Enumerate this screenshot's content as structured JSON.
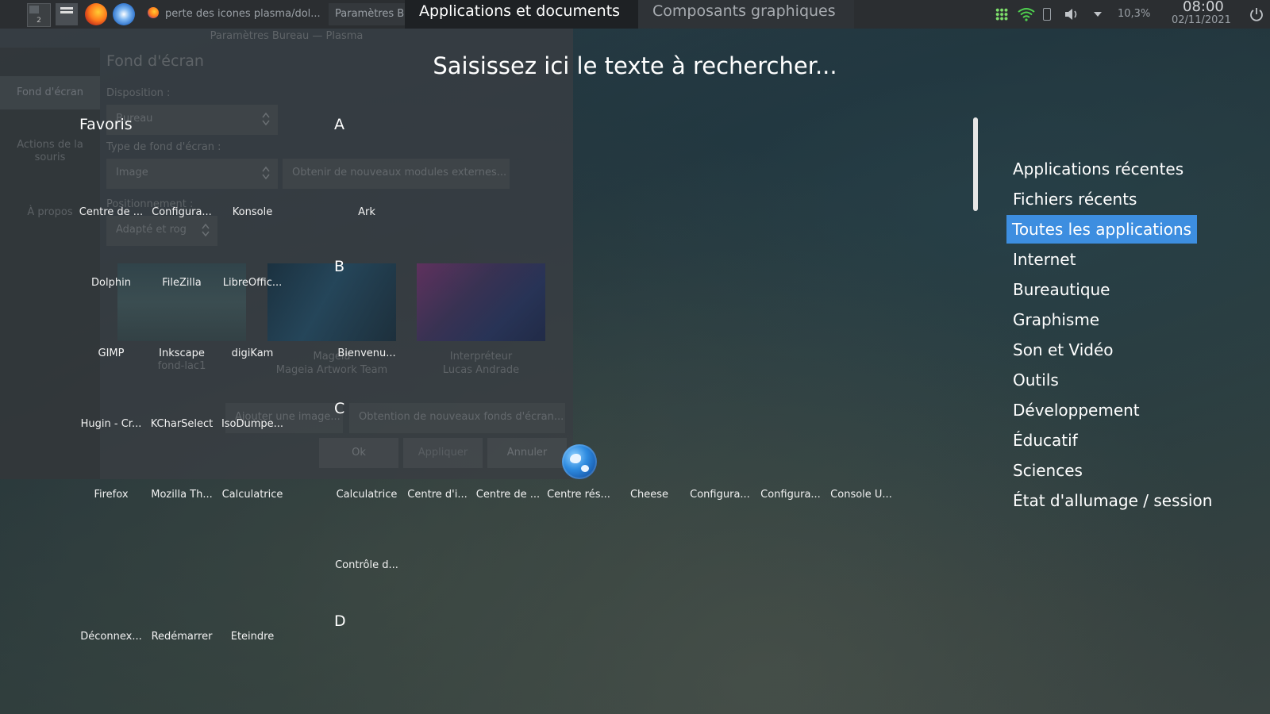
{
  "taskbar": {
    "pager_label": "2",
    "tasks": [
      "perte des icones plasma/dol...",
      "Paramètres B"
    ],
    "launcher_tabs": [
      "Applications et documents",
      "Composants graphiques"
    ],
    "cpu": "10,3%",
    "time": "08:00",
    "date": "02/11/2021"
  },
  "settings_window": {
    "title": "Paramètres Bureau — Plasma",
    "sidebar": [
      "Fond d'écran",
      "Actions de la souris",
      "À propos"
    ],
    "heading": "Fond d'écran",
    "layout_label": "Disposition :",
    "layout_value": "Bureau",
    "type_label": "Type de fond d'écran :",
    "type_value": "Image",
    "get_plugins": "Obtenir de nouveaux modules externes...",
    "position_label": "Positionnement :",
    "position_value": "Adapté et rog",
    "thumbs": [
      {
        "name": "fond-lac1",
        "author": ""
      },
      {
        "name": "Mageia",
        "author": "Mageia Artwork Team"
      },
      {
        "name": "Interpréteur",
        "author": "Lucas Andrade"
      }
    ],
    "add_image": "Ajouter une image...",
    "get_wallpapers": "Obtention de nouveaux fonds d'écran...",
    "ok": "Ok",
    "apply": "Appliquer",
    "cancel": "Annuler"
  },
  "launcher": {
    "search_placeholder": "Saisissez ici le texte à rechercher...",
    "favorites_label": "Favoris",
    "favorites": [
      "Centre de ...",
      "Configura...",
      "Konsole",
      "Dolphin",
      "FileZilla",
      "LibreOffic...",
      "GIMP",
      "Inkscape",
      "digiKam",
      "Hugin - Cr...",
      "KCharSelect",
      "IsoDumpe...",
      "Firefox",
      "Mozilla Th...",
      "Calculatrice",
      "Déconnex...",
      "Redémarrer",
      "Éteindre"
    ],
    "sections": [
      "A",
      "B",
      "C",
      "D"
    ],
    "section_a": [
      "Ark"
    ],
    "section_b": [
      "Bienvenu..."
    ],
    "section_c_row1": [
      "Calculatrice",
      "Centre d'i...",
      "Centre de ...",
      "Centre rés...",
      "Cheese",
      "Configura...",
      "Configura...",
      "Console U..."
    ],
    "section_c_row2": [
      "Contrôle d..."
    ],
    "categories": [
      "Applications récentes",
      "Fichiers récents",
      "Toutes les applications",
      "Internet",
      "Bureautique",
      "Graphisme",
      "Son et Vidéo",
      "Outils",
      "Développement",
      "Éducatif",
      "Sciences",
      "État d'allumage / session"
    ],
    "active_category": "Toutes les applications"
  }
}
